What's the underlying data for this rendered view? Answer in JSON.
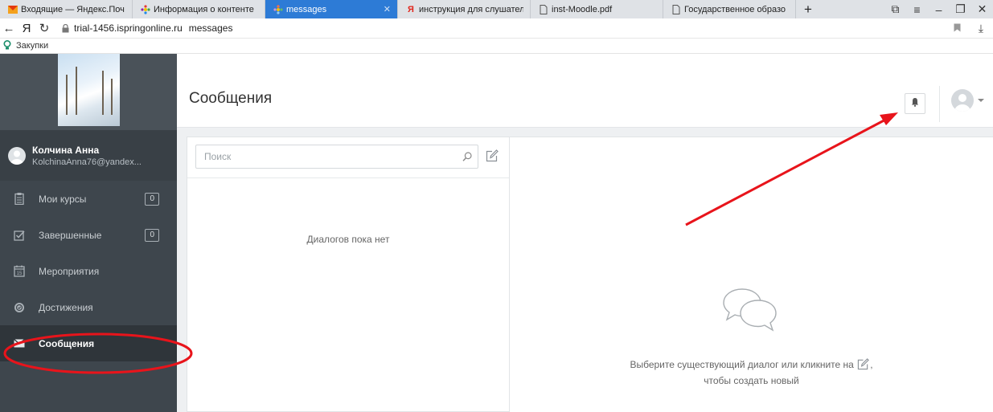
{
  "browser": {
    "tabs": [
      {
        "label": "Входящие — Яндекс.Поч",
        "icon": "mail-icon"
      },
      {
        "label": "Информация о контенте",
        "icon": "ispring-icon"
      },
      {
        "label": "messages",
        "icon": "ispring-icon",
        "active": true
      },
      {
        "label": "инструкция для слушател",
        "icon": "yandex-icon"
      },
      {
        "label": "inst-Moodle.pdf",
        "icon": "document-icon"
      },
      {
        "label": "Государственное образо",
        "icon": "document-icon"
      }
    ],
    "new_tab": "+",
    "url_domain": "trial-1456.ispringonline.ru",
    "url_path": "messages",
    "yandex_letter": "Я",
    "bookmark_label": "Закупки"
  },
  "sidebar": {
    "user_name": "Колчина Анна",
    "user_email": "KolchinaAnna76@yandex...",
    "items": [
      {
        "label": "Мои курсы",
        "badge": "0",
        "icon": "courses-icon"
      },
      {
        "label": "Завершенные",
        "badge": "0",
        "icon": "completed-icon"
      },
      {
        "label": "Мероприятия",
        "icon": "calendar-icon"
      },
      {
        "label": "Достижения",
        "icon": "achievements-icon"
      },
      {
        "label": "Сообщения",
        "icon": "envelope-icon",
        "active": true
      }
    ]
  },
  "main": {
    "title": "Сообщения",
    "search_placeholder": "Поиск",
    "empty_list": "Диалогов пока нет",
    "hint_line1": "Выберите существующий диалог или кликните на",
    "hint_line1_end": ",",
    "hint_line2": "чтобы создать новый"
  },
  "colors": {
    "active_tab": "#2d7bd6",
    "sidebar_bg": "#3e464d",
    "annotation_red": "#e8141b"
  }
}
